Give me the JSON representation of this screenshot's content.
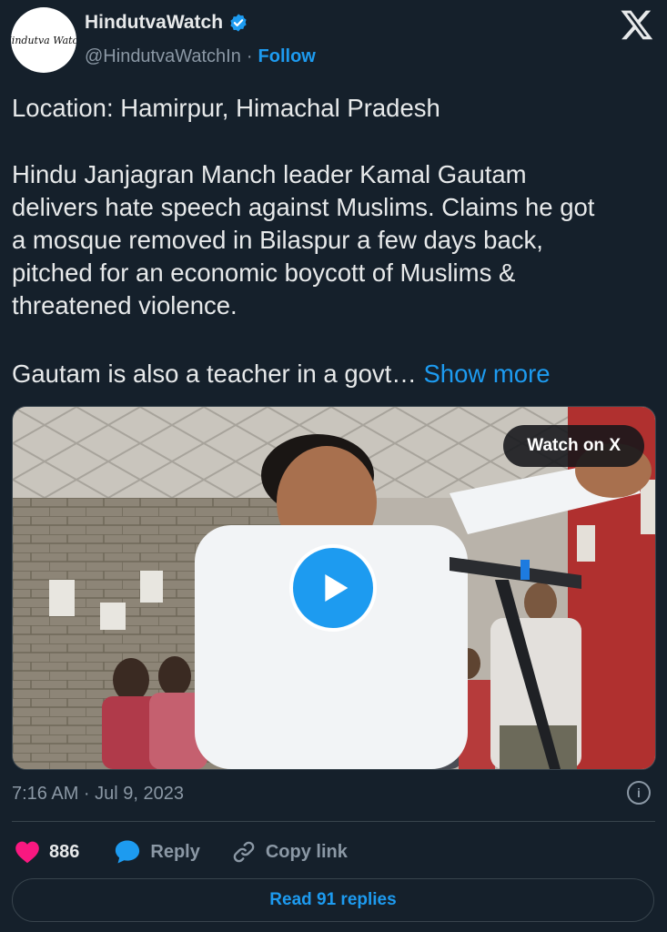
{
  "account": {
    "name": "HindutvaWatch",
    "handle": "@HindutvaWatchIn",
    "separator": "·",
    "follow_label": "Follow",
    "avatar_text": "Hindutva Watch"
  },
  "post": {
    "location_line": "Location: Hamirpur, Himachal Pradesh",
    "body_lines": [
      "Hindu Janjagran Manch leader Kamal Gautam",
      "delivers hate speech against Muslims. Claims he got",
      "a mosque removed in Bilaspur a few days back,",
      "pitched for an economic boycott of Muslims &",
      "threatened violence."
    ],
    "truncated_line": "Gautam is also a teacher in a govt…",
    "show_more_label": "Show more"
  },
  "media": {
    "watch_label": "Watch on X"
  },
  "meta": {
    "timestamp": "7:16 AM · Jul 9, 2023"
  },
  "actions": {
    "like_count": "886",
    "reply_label": "Reply",
    "copy_link_label": "Copy link"
  },
  "read_replies_label": "Read 91 replies",
  "colors": {
    "background": "#15202b",
    "accent": "#1d9bf0",
    "like": "#f91880",
    "muted": "#8b98a5"
  }
}
